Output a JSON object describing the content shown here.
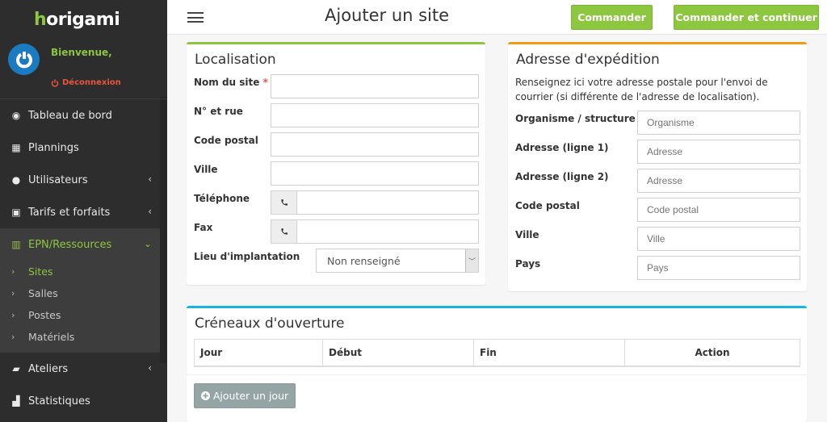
{
  "brand": {
    "logo_first": "h",
    "logo_rest": "origami",
    "accent": "#8dc63f"
  },
  "user": {
    "welcome": "Bienvenue,",
    "logout_label": "Déconnexion"
  },
  "sidebar": {
    "items": [
      {
        "label": "Tableau de bord",
        "icon": "dashboard-icon",
        "chevron": ""
      },
      {
        "label": "Plannings",
        "icon": "calendar-icon",
        "chevron": ""
      },
      {
        "label": "Utilisateurs",
        "icon": "users-icon",
        "chevron": "‹"
      },
      {
        "label": "Tarifs et forfaits",
        "icon": "money-icon",
        "chevron": "‹"
      },
      {
        "label": "EPN/Ressources",
        "icon": "building-icon",
        "chevron": "⌄"
      },
      {
        "label": "Ateliers",
        "icon": "book-icon",
        "chevron": "‹"
      },
      {
        "label": "Statistiques",
        "icon": "bar-chart-icon",
        "chevron": ""
      }
    ],
    "submenu": [
      {
        "label": "Sites",
        "arrow": "›"
      },
      {
        "label": "Salles",
        "arrow": "›"
      },
      {
        "label": "Postes",
        "arrow": "›"
      },
      {
        "label": "Matériels",
        "arrow": "›"
      }
    ]
  },
  "header": {
    "title": "Ajouter un site",
    "order_label": "Commander",
    "order_continue_label": "Commander et continuer"
  },
  "localisation": {
    "title": "Localisation",
    "fields": {
      "name": {
        "label": "Nom du site",
        "required": "*",
        "value": ""
      },
      "street": {
        "label": "N° et rue",
        "value": ""
      },
      "postal": {
        "label": "Code postal",
        "value": ""
      },
      "city": {
        "label": "Ville",
        "value": ""
      },
      "phone": {
        "label": "Téléphone",
        "value": ""
      },
      "fax": {
        "label": "Fax",
        "value": ""
      },
      "location": {
        "label": "Lieu d'implantation",
        "selected": "Non renseigné"
      }
    }
  },
  "shipping": {
    "title": "Adresse d'expédition",
    "description": "Renseignez ici votre adresse postale pour l'envoi de courrier (si différente de l'adresse de localisation).",
    "fields": [
      {
        "label": "Organisme / structure",
        "placeholder": "Organisme"
      },
      {
        "label": "Adresse (ligne 1)",
        "placeholder": "Adresse"
      },
      {
        "label": "Adresse (ligne 2)",
        "placeholder": "Adresse"
      },
      {
        "label": "Code postal",
        "placeholder": "Code postal"
      },
      {
        "label": "Ville",
        "placeholder": "Ville"
      },
      {
        "label": "Pays",
        "placeholder": "Pays"
      }
    ]
  },
  "slots": {
    "title": "Créneaux d'ouverture",
    "columns": [
      "Jour",
      "Début",
      "Fin",
      "Action"
    ],
    "rows": [],
    "add_label": "Ajouter un jour"
  }
}
